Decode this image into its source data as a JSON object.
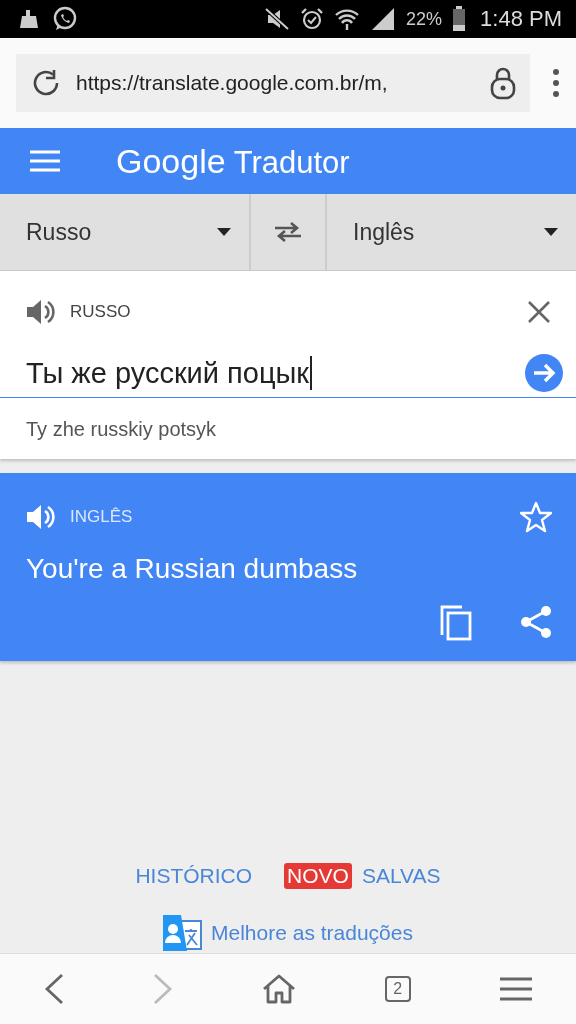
{
  "status_bar": {
    "battery": "22%",
    "time": "1:48 PM"
  },
  "browser": {
    "url": "https://translate.google.com.br/m,",
    "tab_count": "2",
    "forward_disabled": true
  },
  "header": {
    "logo": "Google",
    "title": "Tradutor"
  },
  "languages": {
    "source": "Russo",
    "target": "Inglês"
  },
  "input": {
    "language": "RUSSO",
    "value": "Ты же русский поцык",
    "transliteration": "Ty zhe russkiy potsyk"
  },
  "result": {
    "language": "INGLÊS",
    "text": "You're a Russian dumbass",
    "starred": false
  },
  "links": [
    {
      "label": "HISTÓRICO"
    },
    {
      "badge": "NOVO",
      "label": "SALVAS"
    }
  ],
  "improve_link": "Melhore as traduções"
}
